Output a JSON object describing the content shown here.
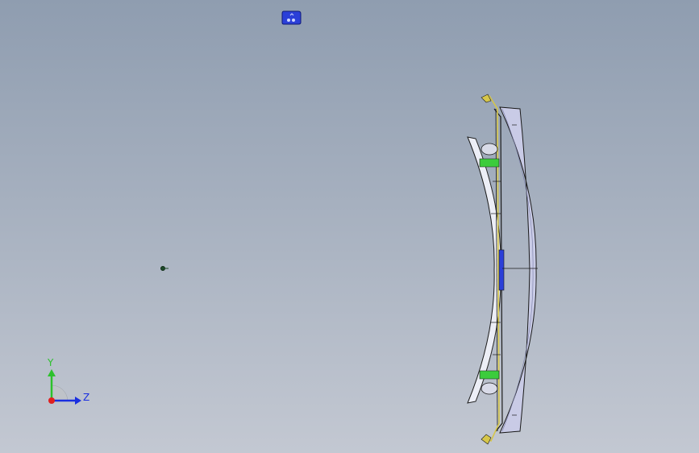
{
  "viewport": {
    "background_top": "#8f9db0",
    "background_bottom": "#c3c8d2"
  },
  "model": {
    "part_color": "#c9cbe6",
    "edge_color": "#1a1a1a",
    "accent_yellow": "#d6c64a",
    "accent_green": "#3ccc3c",
    "small_part_color": "#2b3fd8"
  },
  "triad": {
    "y_label": "Y",
    "z_label": "Z",
    "y_color": "#2cc12c",
    "z_color": "#1a2fe0",
    "x_color": "#e02020"
  }
}
